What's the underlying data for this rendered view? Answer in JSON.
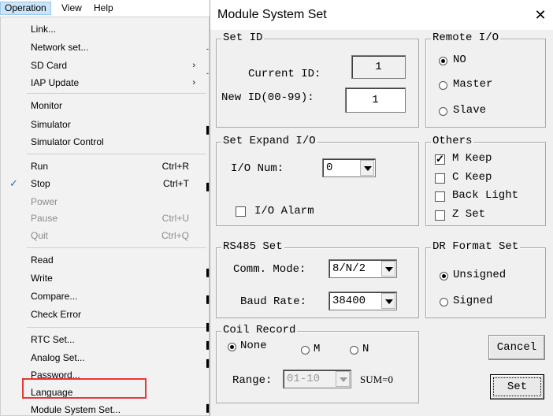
{
  "menubar": {
    "items": [
      "Operation",
      "View",
      "Help"
    ],
    "active": "Operation"
  },
  "menu": {
    "items": [
      {
        "label": "Link...",
        "shortcut": "",
        "arrow": false,
        "checked": false,
        "disabled": false
      },
      {
        "label": "Network set...",
        "shortcut": "",
        "arrow": false,
        "checked": false,
        "disabled": false
      },
      {
        "label": "SD Card",
        "shortcut": "",
        "arrow": true,
        "checked": false,
        "disabled": false
      },
      {
        "label": "IAP Update",
        "shortcut": "",
        "arrow": true,
        "checked": false,
        "disabled": false
      },
      {
        "label": "Monitor",
        "shortcut": "",
        "arrow": false,
        "checked": false,
        "disabled": false
      },
      {
        "label": "Simulator",
        "shortcut": "",
        "arrow": false,
        "checked": false,
        "disabled": false
      },
      {
        "label": "Simulator Control",
        "shortcut": "",
        "arrow": false,
        "checked": false,
        "disabled": false
      },
      {
        "label": "Run",
        "shortcut": "Ctrl+R",
        "arrow": false,
        "checked": false,
        "disabled": false
      },
      {
        "label": "Stop",
        "shortcut": "Ctrl+T",
        "arrow": false,
        "checked": true,
        "disabled": false
      },
      {
        "label": "Power",
        "shortcut": "",
        "arrow": false,
        "checked": false,
        "disabled": true
      },
      {
        "label": "Pause",
        "shortcut": "Ctrl+U",
        "arrow": false,
        "checked": false,
        "disabled": true
      },
      {
        "label": "Quit",
        "shortcut": "Ctrl+Q",
        "arrow": false,
        "checked": false,
        "disabled": true
      },
      {
        "label": "Read",
        "shortcut": "",
        "arrow": false,
        "checked": false,
        "disabled": false
      },
      {
        "label": "Write",
        "shortcut": "",
        "arrow": false,
        "checked": false,
        "disabled": false
      },
      {
        "label": "Compare...",
        "shortcut": "",
        "arrow": false,
        "checked": false,
        "disabled": false
      },
      {
        "label": "Check Error",
        "shortcut": "",
        "arrow": false,
        "checked": false,
        "disabled": false
      },
      {
        "label": "RTC Set...",
        "shortcut": "",
        "arrow": false,
        "checked": false,
        "disabled": false
      },
      {
        "label": "Analog Set...",
        "shortcut": "",
        "arrow": false,
        "checked": false,
        "disabled": false
      },
      {
        "label": "Password...",
        "shortcut": "",
        "arrow": false,
        "checked": false,
        "disabled": false
      },
      {
        "label": "Language",
        "shortcut": "",
        "arrow": false,
        "checked": false,
        "disabled": false
      },
      {
        "label": "Module System Set...",
        "shortcut": "",
        "arrow": false,
        "checked": false,
        "disabled": false,
        "highlighted": true
      }
    ],
    "highlight_color": "#e53935"
  },
  "dialog": {
    "title": "Module System Set",
    "close_glyph": "✕",
    "set_id": {
      "title": "Set ID",
      "current_label": "Current ID:",
      "current_value": "1",
      "new_label": "New ID(00-99):",
      "new_value": "1"
    },
    "remote_io": {
      "title": "Remote I/O",
      "options": [
        "NO",
        "Master",
        "Slave"
      ],
      "selected": "NO"
    },
    "expand_io": {
      "title": "Set Expand I/O",
      "num_label": "I/O Num:",
      "num_value": "0",
      "alarm_label": "I/O Alarm",
      "alarm_checked": false
    },
    "others": {
      "title": "Others",
      "options": [
        {
          "label": "M Keep",
          "checked": true
        },
        {
          "label": "C Keep",
          "checked": false
        },
        {
          "label": "Back Light",
          "checked": false
        },
        {
          "label": "Z Set",
          "checked": false
        }
      ]
    },
    "rs485": {
      "title": "RS485 Set",
      "mode_label": "Comm. Mode:",
      "mode_value": "8/N/2",
      "baud_label": "Baud Rate:",
      "baud_value": "38400"
    },
    "dr_format": {
      "title": "DR Format Set",
      "options": [
        "Unsigned",
        "Signed"
      ],
      "selected": "Unsigned"
    },
    "coil_record": {
      "title": "Coil Record",
      "options": [
        "None",
        "M",
        "N"
      ],
      "selected": "None",
      "range_label": "Range:",
      "range_value": "01-10",
      "sum_text": "SUM=0"
    },
    "buttons": {
      "cancel": "Cancel",
      "set": "Set"
    }
  }
}
